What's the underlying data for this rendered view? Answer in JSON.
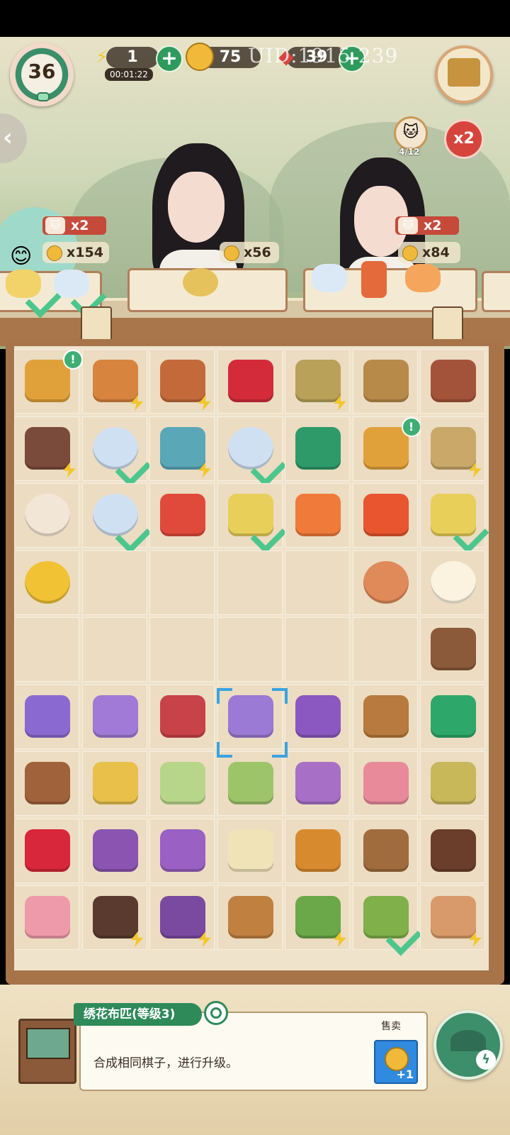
{
  "hud": {
    "level": "36",
    "energy": "1",
    "energy_timer": "00:01:22",
    "coins": "75",
    "gems": "39",
    "uid": "UID:1915 239",
    "plus": "+"
  },
  "customers": [
    {
      "id": "left",
      "multiplier": "x2",
      "reward": "x154"
    },
    {
      "id": "middle",
      "reward": "x56"
    },
    {
      "id": "right",
      "multiplier": "x2",
      "reward": "x84",
      "progress": "4/12"
    }
  ],
  "global_multiplier": "x2",
  "board": {
    "rows": [
      [
        "money-bag",
        "fruit-crate",
        "energy-gourd",
        "red-gems",
        "fruit-basket",
        "chicks-nest",
        "chicken-coop"
      ],
      [
        "treasure-chest",
        "tea-cup",
        "teapot",
        "tea-cup",
        "green-gourd",
        "money-bag",
        "scroll-box"
      ],
      [
        "dumpling",
        "tea-cup",
        "watermelon-plate",
        "fried-rice",
        "orange-lantern",
        "red-lantern",
        "fried-rice"
      ],
      [
        "gold-coins",
        "",
        "",
        "",
        "",
        "egg",
        "fried-egg"
      ],
      [
        "",
        "",
        "",
        "",
        "",
        "",
        "wood-log"
      ],
      [
        "purple-pouch",
        "folded-cloth",
        "red-fabric",
        "embroidered-cloth",
        "purple-sachet",
        "wooden-paddle",
        "mystery-box"
      ],
      [
        "wooden-planks",
        "jade-bracelet",
        "pea-soup",
        "bamboo-shoots",
        "flower-sachet",
        "peach-cake",
        "soup-pot"
      ],
      [
        "red-gem-cluster",
        "decorated-bag",
        "purple-bag",
        "popcorn-bowl",
        "roast-chicken",
        "wooden-boat",
        "covered-boat"
      ],
      [
        "flower-cake",
        "jewelry-box",
        "fabric-loom",
        "oars",
        "fruit-tree",
        "pickle-jar",
        "cake-crate"
      ]
    ]
  },
  "selected_item": {
    "name": "绣花布匹(等级3)",
    "description": "合成相同棋子，进行升级。",
    "sell_label": "售卖",
    "sell_value": "+1"
  },
  "colors": {
    "accent_green": "#2f8a5a",
    "board_bg": "#efe3cc",
    "frame": "#a7744a",
    "energy": "#f2c72c",
    "badge_red": "#d6453d"
  }
}
